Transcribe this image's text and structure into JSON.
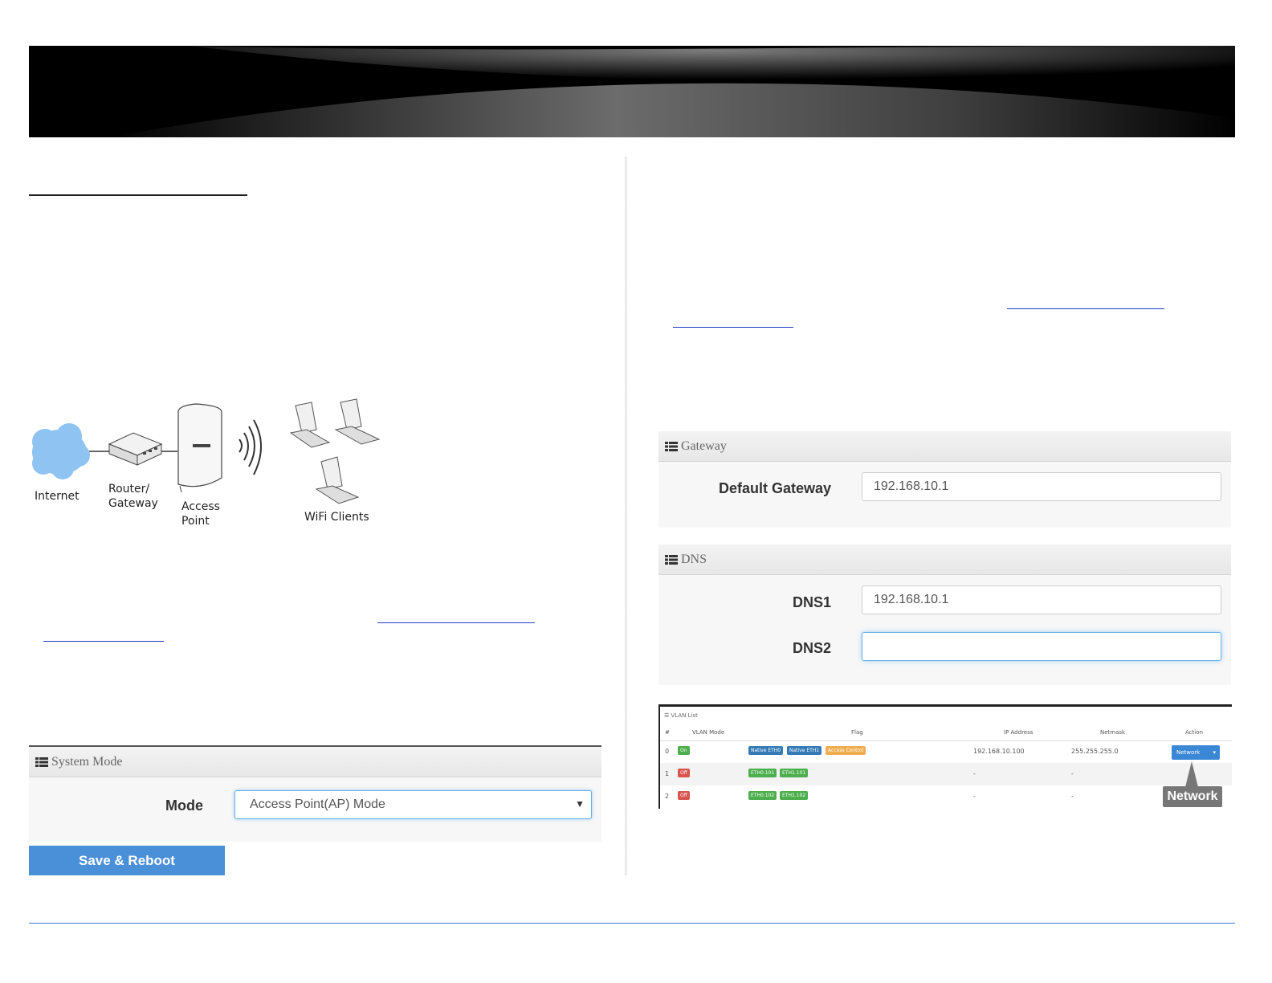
{
  "diagram": {
    "labels": {
      "internet": "Internet",
      "router_line1": "Router/",
      "router_line2": "Gateway",
      "ap_line1": "Access",
      "ap_line2": "Point",
      "clients": "WiFi Clients"
    }
  },
  "system_mode_panel": {
    "title": "System Mode",
    "mode_label": "Mode",
    "mode_value": "Access Point(AP) Mode",
    "save_button": "Save & Reboot"
  },
  "gateway_panel": {
    "title": "Gateway",
    "default_gateway_label": "Default Gateway",
    "default_gateway_value": "192.168.10.1"
  },
  "dns_panel": {
    "title": "DNS",
    "dns1_label": "DNS1",
    "dns1_value": "192.168.10.1",
    "dns2_label": "DNS2",
    "dns2_value": ""
  },
  "vlan_list": {
    "title": "VLAN List",
    "headers": [
      "#",
      "VLAN Mode",
      "Flag",
      "IP Address",
      "Netmask",
      "Action"
    ],
    "rows": [
      {
        "index": "0",
        "mode": "On",
        "flags": [
          "Native ETH0",
          "Native ETH1",
          "Access Control"
        ],
        "ip": "192.168.10.100",
        "netmask": "255.255.255.0",
        "action": "Network"
      },
      {
        "index": "1",
        "mode": "Off",
        "flags": [
          "ETH0.101",
          "ETH1.101"
        ],
        "ip": "-",
        "netmask": "-"
      },
      {
        "index": "2",
        "mode": "Off",
        "flags": [
          "ETH0.102",
          "ETH1.102"
        ],
        "ip": "-",
        "netmask": "-"
      }
    ],
    "callout": "Network"
  },
  "colors": {
    "accent_blue": "#4a90d9",
    "footer_line": "#3b7fd4",
    "link": "#1a3cc8"
  }
}
